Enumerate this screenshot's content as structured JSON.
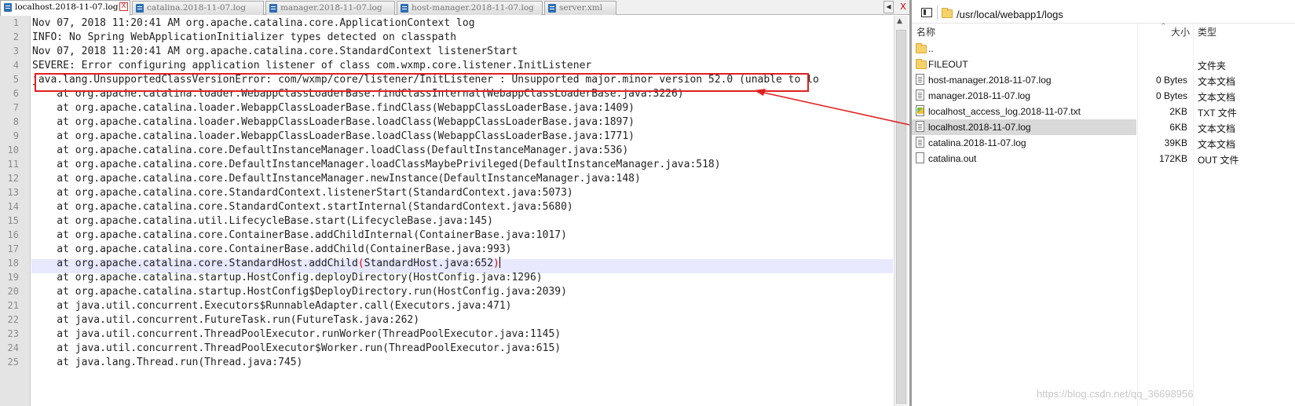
{
  "editor": {
    "tabs": [
      {
        "label": "localhost.2018-11-07.log",
        "active": true
      },
      {
        "label": "catalina.2018-11-07.log",
        "active": false
      },
      {
        "label": "manager.2018-11-07.log",
        "active": false
      },
      {
        "label": "host-manager.2018-11-07.log",
        "active": false
      },
      {
        "label": "server.xml",
        "active": false
      }
    ],
    "close_glyph": "X",
    "nav_prev_glyph": "◀",
    "nav_next_glyph": "▶",
    "current_line": 18,
    "lines": [
      "Nov 07, 2018 11:20:41 AM org.apache.catalina.core.ApplicationContext log",
      "INFO: No Spring WebApplicationInitializer types detected on classpath",
      "Nov 07, 2018 11:20:41 AM org.apache.catalina.core.StandardContext listenerStart",
      "SEVERE: Error configuring application listener of class com.wxmp.core.listener.InitListener",
      "java.lang.UnsupportedClassVersionError: com/wxmp/core/listener/InitListener : Unsupported major.minor version 52.0 (unable to lo",
      "    at org.apache.catalina.loader.WebappClassLoaderBase.findClassInternal(WebappClassLoaderBase.java:3226)",
      "    at org.apache.catalina.loader.WebappClassLoaderBase.findClass(WebappClassLoaderBase.java:1409)",
      "    at org.apache.catalina.loader.WebappClassLoaderBase.loadClass(WebappClassLoaderBase.java:1897)",
      "    at org.apache.catalina.loader.WebappClassLoaderBase.loadClass(WebappClassLoaderBase.java:1771)",
      "    at org.apache.catalina.core.DefaultInstanceManager.loadClass(DefaultInstanceManager.java:536)",
      "    at org.apache.catalina.core.DefaultInstanceManager.loadClassMaybePrivileged(DefaultInstanceManager.java:518)",
      "    at org.apache.catalina.core.DefaultInstanceManager.newInstance(DefaultInstanceManager.java:148)",
      "    at org.apache.catalina.core.StandardContext.listenerStart(StandardContext.java:5073)",
      "    at org.apache.catalina.core.StandardContext.startInternal(StandardContext.java:5680)",
      "    at org.apache.catalina.util.LifecycleBase.start(LifecycleBase.java:145)",
      "    at org.apache.catalina.core.ContainerBase.addChildInternal(ContainerBase.java:1017)",
      "    at org.apache.catalina.core.ContainerBase.addChild(ContainerBase.java:993)",
      "    at org.apache.catalina.core.StandardHost.addChild(StandardHost.java:652)",
      "    at org.apache.catalina.startup.HostConfig.deployDirectory(HostConfig.java:1296)",
      "    at org.apache.catalina.startup.HostConfig$DeployDirectory.run(HostConfig.java:2039)",
      "    at java.util.concurrent.Executors$RunnableAdapter.call(Executors.java:471)",
      "    at java.util.concurrent.FutureTask.run(FutureTask.java:262)",
      "    at java.util.concurrent.ThreadPoolExecutor.runWorker(ThreadPoolExecutor.java:1145)",
      "    at java.util.concurrent.ThreadPoolExecutor$Worker.run(ThreadPoolExecutor.java:615)",
      "    at java.lang.Thread.run(Thread.java:745)"
    ]
  },
  "explorer": {
    "path": "/usr/local/webapp1/logs",
    "columns": {
      "name": "名称",
      "size": "大小",
      "type": "类型"
    },
    "sort_glyph": "^",
    "files": [
      {
        "name": "..",
        "size": "",
        "type": "",
        "icon": "folder-icon"
      },
      {
        "name": "FILEOUT",
        "size": "",
        "type": "文件夹",
        "icon": "folder-icon"
      },
      {
        "name": "host-manager.2018-11-07.log",
        "size": "0 Bytes",
        "type": "文本文档",
        "icon": "document-icon"
      },
      {
        "name": "manager.2018-11-07.log",
        "size": "0 Bytes",
        "type": "文本文档",
        "icon": "document-icon"
      },
      {
        "name": "localhost_access_log.2018-11-07.txt",
        "size": "2KB",
        "type": "TXT 文件",
        "icon": "text-file-icon"
      },
      {
        "name": "localhost.2018-11-07.log",
        "size": "6KB",
        "type": "文本文档",
        "icon": "document-icon",
        "selected": true
      },
      {
        "name": "catalina.2018-11-07.log",
        "size": "39KB",
        "type": "文本文档",
        "icon": "document-icon"
      },
      {
        "name": "catalina.out",
        "size": "172KB",
        "type": "OUT 文件",
        "icon": "blank-file-icon"
      }
    ]
  },
  "watermark": "https://blog.csdn.net/qq_36698956",
  "colors": {
    "annotation": "#e02020",
    "current_line": "#e8e8ff",
    "selection": "#d9d9d9"
  }
}
